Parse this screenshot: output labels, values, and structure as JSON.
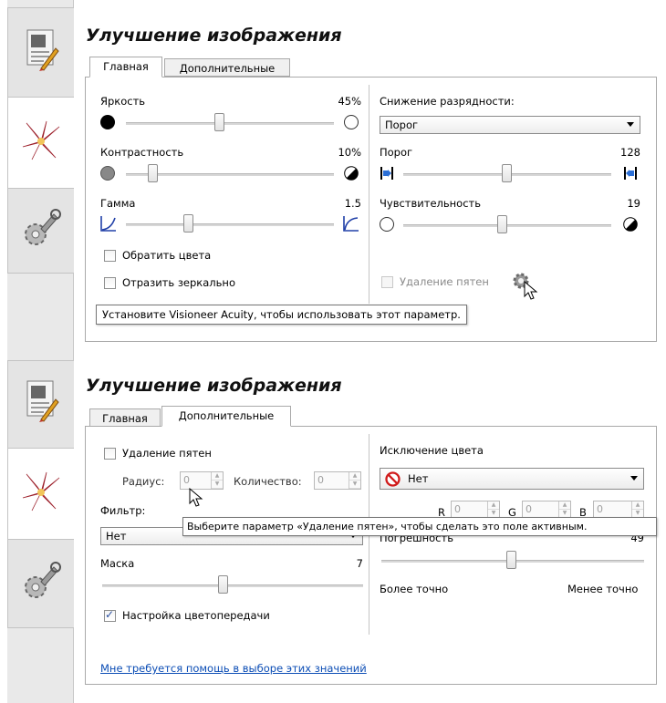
{
  "top": {
    "title": "Улучшение изображения",
    "tabs": [
      {
        "label": "Главная",
        "active": true
      },
      {
        "label": "Дополнительные",
        "active": false
      }
    ],
    "brightness": {
      "label": "Яркость",
      "value": "45%",
      "level": 0.45
    },
    "contrast": {
      "label": "Контрастность",
      "value": "10%",
      "level": 0.1
    },
    "gamma": {
      "label": "Гамма",
      "value": "1.5",
      "level": 0.35
    },
    "invert_label": "Обратить цвета",
    "mirror_label": "Отразить зеркально",
    "bitdepth_label": "Снижение разрядности:",
    "bitdepth_value": "Порог",
    "threshold": {
      "label": "Порог",
      "value": "128",
      "level": 0.5
    },
    "sensitivity": {
      "label": "Чувствительность",
      "value": "19",
      "level": 0.5
    },
    "despeckle_label": "Удаление пятен",
    "tooltip": "Установите Visioneer Acuity, чтобы использовать этот параметр."
  },
  "bottom": {
    "title": "Улучшение изображения",
    "tabs": [
      {
        "label": "Главная",
        "active": false
      },
      {
        "label": "Дополнительные",
        "active": true
      }
    ],
    "despeckle_label": "Удаление пятен",
    "radius_label": "Радиус:",
    "radius_value": "0",
    "quantity_label": "Количество:",
    "quantity_value": "0",
    "filter_label": "Фильтр:",
    "filter_value": "Нет",
    "mask": {
      "label": "Маска",
      "value": "7",
      "level": 0.45
    },
    "color_correction_label": "Настройка цветопередачи",
    "help_link": "Мне требуется помощь в выборе этих значений",
    "color_drop_label": "Исключение цвета",
    "color_drop_value": "Нет",
    "r_label": "R",
    "r_value": "0",
    "g_label": "G",
    "g_value": "0",
    "b_label": "B",
    "b_value": "0",
    "tolerance": {
      "label": "Погрешность",
      "value": "49",
      "level": 0.5
    },
    "more_precise": "Более точно",
    "less_precise": "Менее точно",
    "tooltip": "Выберите параметр «Удаление пятен», чтобы сделать это поле активным."
  },
  "colors": {
    "link": "#0b4db5",
    "accent_red": "#d01b1b",
    "tooltip_border": "#767676"
  }
}
